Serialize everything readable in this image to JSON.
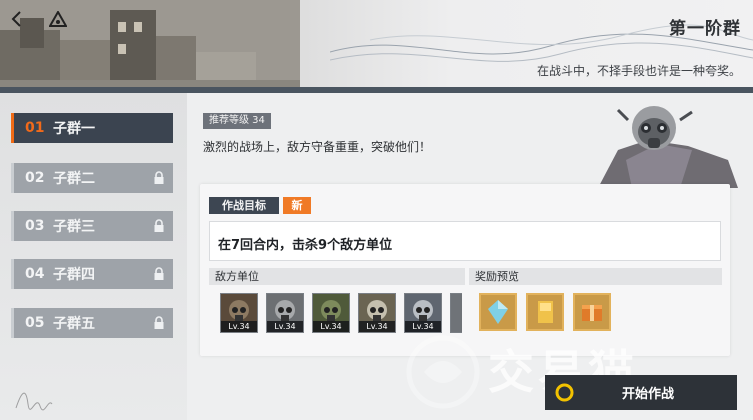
{
  "header": {
    "title": "第一阶群",
    "subtitle": "在战斗中，不择手段也许是一种夸奖。",
    "icons": [
      "back-arrow-icon",
      "home-triangle-icon"
    ]
  },
  "groups": [
    {
      "num": "01",
      "name": "子群一",
      "active": true,
      "locked": false
    },
    {
      "num": "02",
      "name": "子群二",
      "active": false,
      "locked": true
    },
    {
      "num": "03",
      "name": "子群三",
      "active": false,
      "locked": true
    },
    {
      "num": "04",
      "name": "子群四",
      "active": false,
      "locked": true
    },
    {
      "num": "05",
      "name": "子群五",
      "active": false,
      "locked": true
    }
  ],
  "stage": {
    "recommended_level": "推荐等级 34",
    "description": "激烈的战场上，敌方守备重重，突破他们！"
  },
  "objective": {
    "tab_label": "作战目标",
    "new_tag": "新",
    "text": "在7回合内，击杀9个敌方单位"
  },
  "enemies": {
    "header": "敌方单位",
    "units": [
      {
        "level": "Lv.34",
        "tone": "#5a4a3a"
      },
      {
        "level": "Lv.34",
        "tone": "#6c6f72"
      },
      {
        "level": "Lv.34",
        "tone": "#4f5a3a"
      },
      {
        "level": "Lv.34",
        "tone": "#6a6452"
      },
      {
        "level": "Lv.34",
        "tone": "#5f6670"
      }
    ]
  },
  "rewards": {
    "header": "奖励预览",
    "items": [
      "crystal-icon",
      "gold-bar-icon",
      "supply-crate-icon"
    ]
  },
  "start_button": {
    "label": "开始作战"
  },
  "watermark": {
    "text": "交易猫"
  },
  "colors": {
    "accent": "#f06b16",
    "dark": "#3b4450",
    "locked": "#9ea3a9"
  }
}
